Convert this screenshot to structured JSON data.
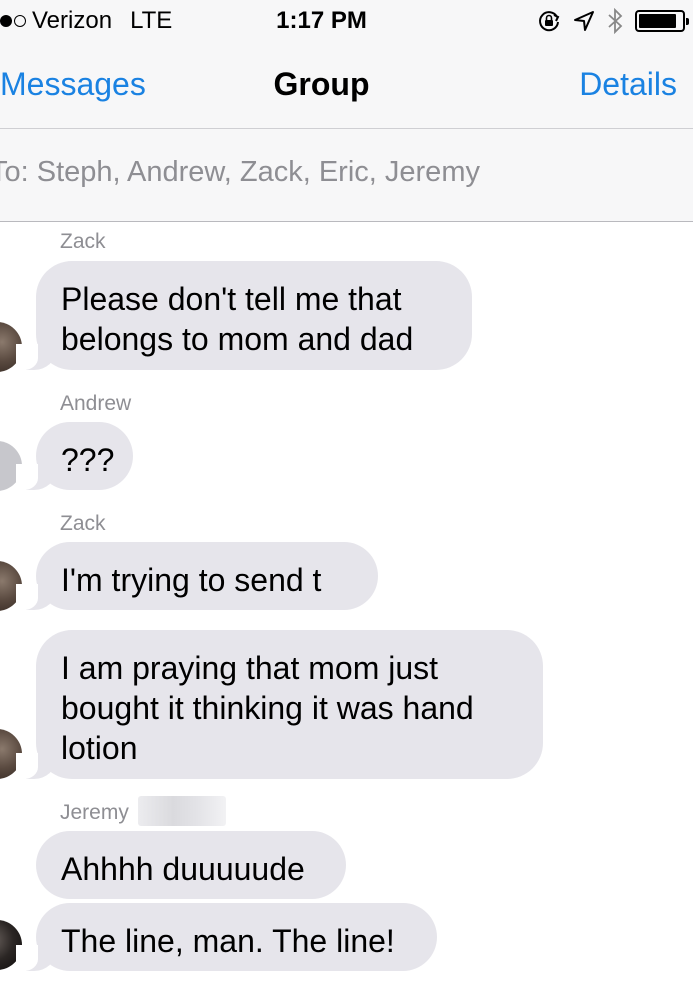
{
  "status_bar": {
    "carrier": "Verizon",
    "network": "LTE",
    "time": "1:17 PM"
  },
  "nav": {
    "back_label": "Messages",
    "title": "Group",
    "details_label": "Details"
  },
  "recipients": {
    "text": "To: Steph, Andrew, Zack, Eric, Jeremy"
  },
  "messages": [
    {
      "sender": "Zack",
      "text": "Please don't tell me that\nbelongs to mom and dad"
    },
    {
      "sender": "Andrew",
      "text": "???"
    },
    {
      "sender": "Zack",
      "text": "I'm trying to send t"
    },
    {
      "sender": "",
      "text": "I am praying that mom just\nbought it thinking it was hand\nlotion"
    },
    {
      "sender": "Jeremy",
      "text": "Ahhhh duuuuude"
    },
    {
      "sender": "",
      "text": "The line, man. The line!"
    }
  ],
  "colors": {
    "accent": "#1a82e2",
    "bubble": "#e6e5eb",
    "sender_text": "#8e8e93"
  },
  "icons": [
    "signal-dots-icon",
    "orientation-lock-icon",
    "location-arrow-icon",
    "bluetooth-icon",
    "battery-icon"
  ]
}
